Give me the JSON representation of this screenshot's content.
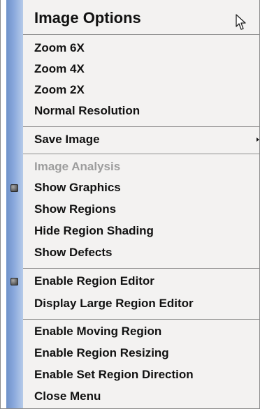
{
  "menu": {
    "title": "Image Options",
    "zoom_items": [
      {
        "label": "Zoom 6X"
      },
      {
        "label": "Zoom 4X"
      },
      {
        "label": "Zoom 2X"
      },
      {
        "label": "Normal Resolution"
      }
    ],
    "save_item": {
      "label": "Save Image",
      "has_submenu": true
    },
    "analysis_header": {
      "label": "Image Analysis",
      "enabled": false
    },
    "analysis_items": [
      {
        "label": "Show Graphics",
        "checked": true
      },
      {
        "label": "Show Regions",
        "checked": false
      },
      {
        "label": "Hide Region Shading",
        "checked": false
      },
      {
        "label": "Show Defects",
        "checked": false
      }
    ],
    "editor_items": [
      {
        "label": "Enable Region Editor",
        "checked": true
      },
      {
        "label": "Display Large Region Editor",
        "checked": false
      }
    ],
    "region_items": [
      {
        "label": "Enable Moving Region"
      },
      {
        "label": "Enable Region Resizing"
      },
      {
        "label": "Enable Set Region Direction"
      },
      {
        "label": "Close Menu"
      }
    ]
  },
  "icons": {
    "cursor": "mouse-pointer-icon",
    "submenu_arrow": "chevron-right-icon",
    "check": "check-bullet-icon"
  },
  "colors": {
    "gutter_blue": "#89a8dc",
    "menu_background": "#f3f2f1",
    "text": "#111111",
    "disabled_text": "#9d9d9d"
  }
}
